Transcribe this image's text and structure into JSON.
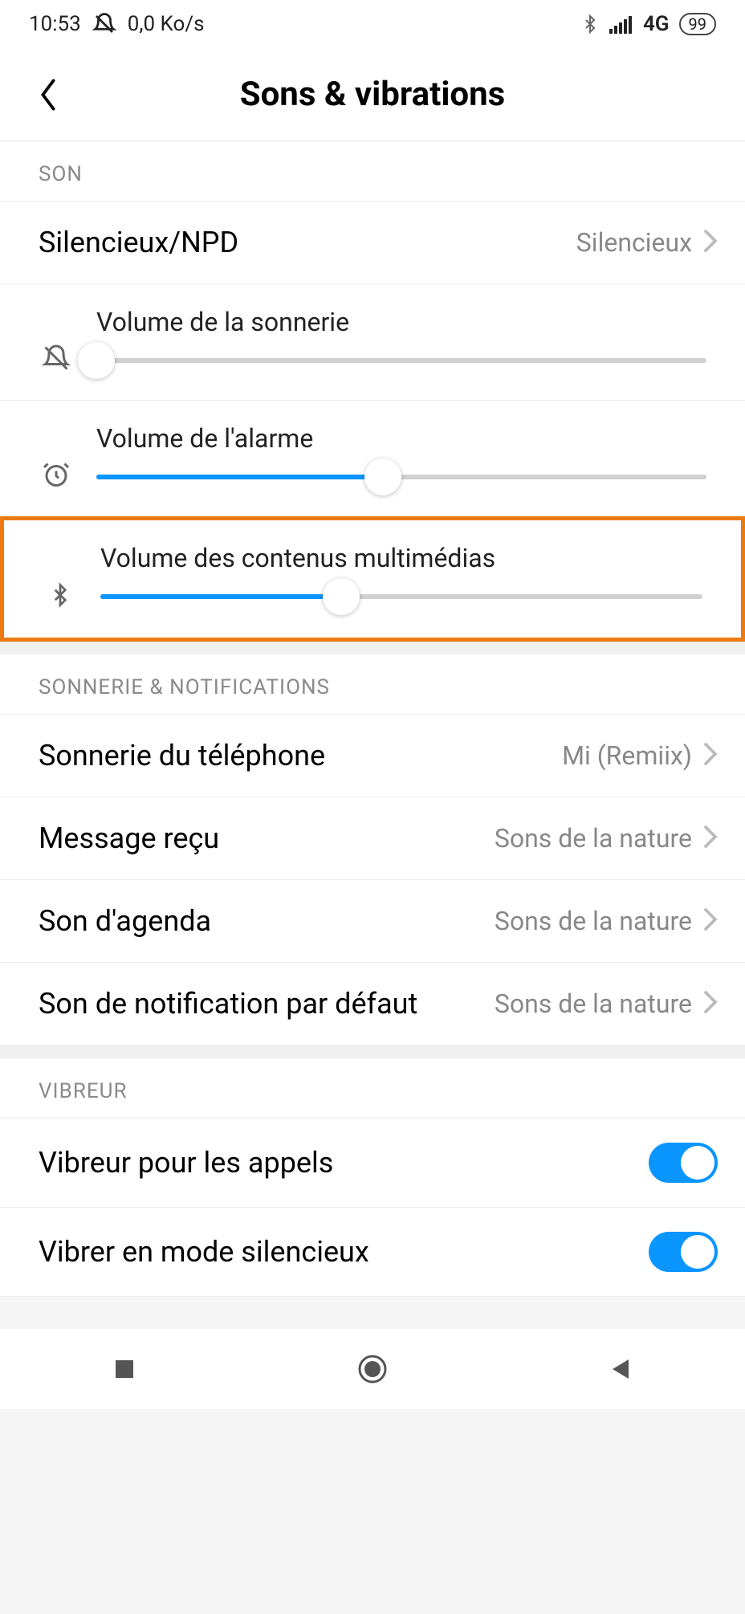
{
  "status": {
    "time": "10:53",
    "speed": "0,0 Ko/s",
    "network": "4G",
    "battery": "99"
  },
  "header": {
    "title": "Sons & vibrations"
  },
  "sections": {
    "son": {
      "label": "SON",
      "silent": {
        "label": "Silencieux/NPD",
        "value": "Silencieux"
      },
      "sliders": {
        "ring": {
          "label": "Volume de la sonnerie",
          "percent": 0
        },
        "alarm": {
          "label": "Volume de l'alarme",
          "percent": 47
        },
        "media": {
          "label": "Volume des contenus multimédias",
          "percent": 40
        }
      }
    },
    "notif": {
      "label": "SONNERIE & NOTIFICATIONS",
      "phone_ringtone": {
        "label": "Sonnerie du téléphone",
        "value": "Mi (Remiix)"
      },
      "message": {
        "label": "Message reçu",
        "value": "Sons de la nature"
      },
      "agenda": {
        "label": "Son d'agenda",
        "value": "Sons de la nature"
      },
      "default_notif": {
        "label": "Son de notification par défaut",
        "value": "Sons de la nature"
      }
    },
    "vibreur": {
      "label": "VIBREUR",
      "calls": {
        "label": "Vibreur pour les appels",
        "on": true
      },
      "silent": {
        "label": "Vibrer en mode silencieux",
        "on": true
      }
    }
  },
  "highlight": "media"
}
